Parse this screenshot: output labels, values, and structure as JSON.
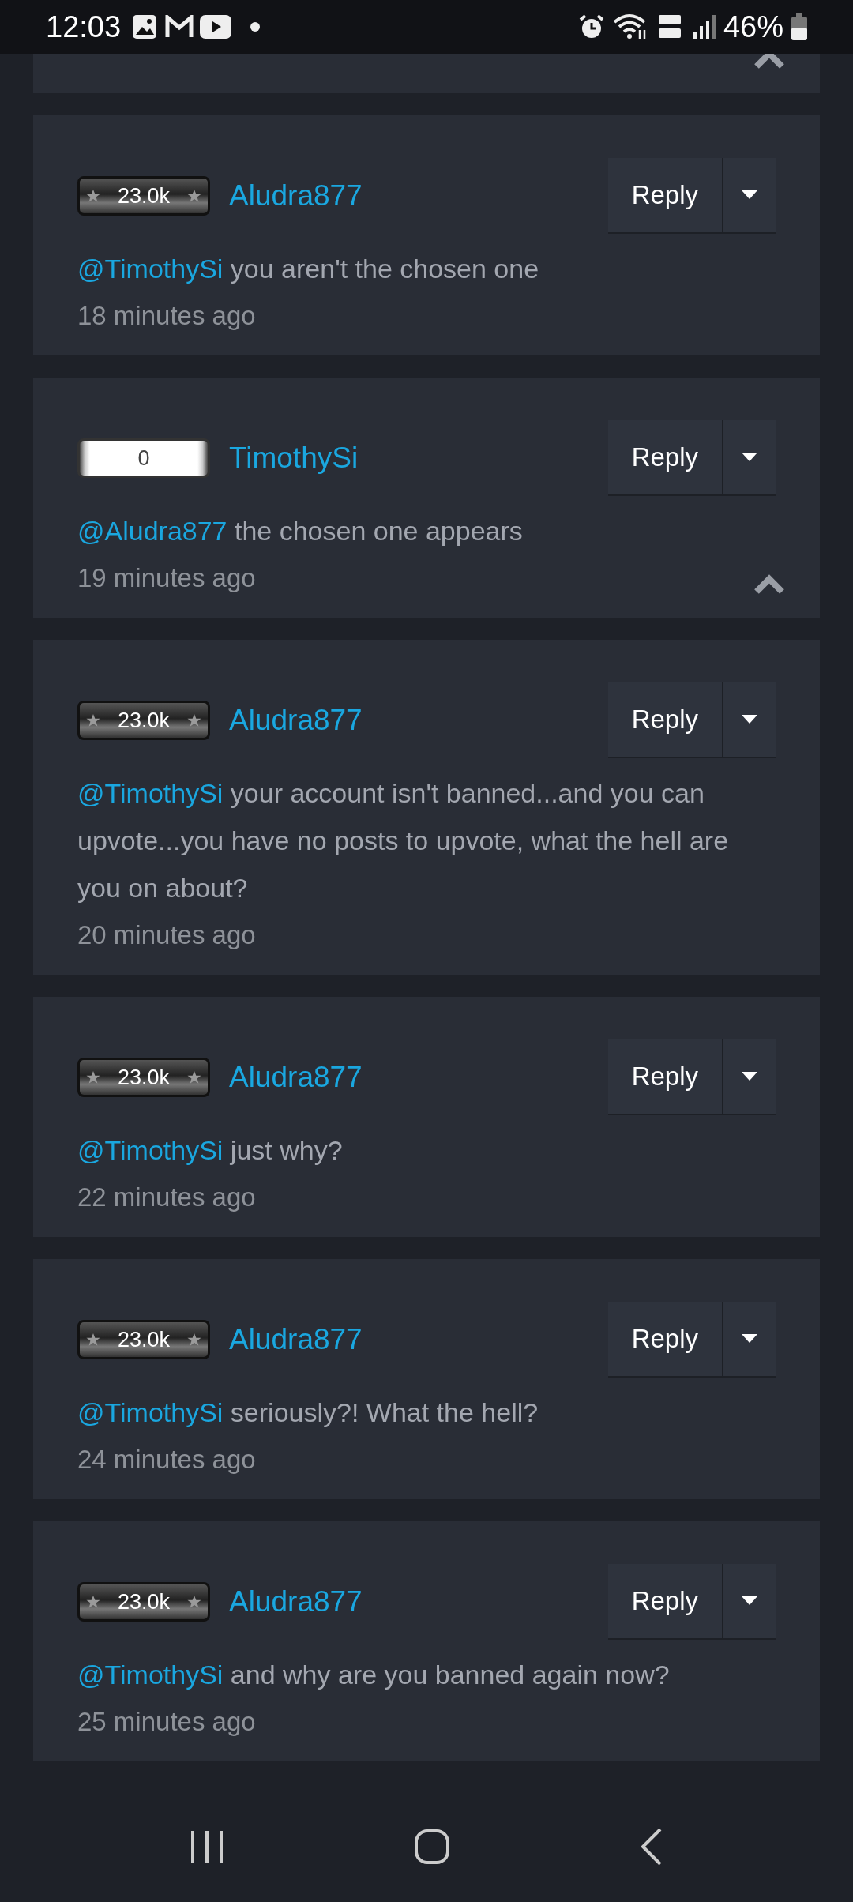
{
  "status_bar": {
    "time": "12:03",
    "battery": "46%"
  },
  "partial_comment": {
    "collapse": true
  },
  "comments": [
    {
      "badge": {
        "text": "23.0k",
        "kind": "dark"
      },
      "author": "Aludra877",
      "mention": "@TimothySi",
      "body": "you aren't the chosen one",
      "time": "18 minutes ago",
      "reply": "Reply",
      "collapse": false
    },
    {
      "badge": {
        "text": "0",
        "kind": "light"
      },
      "author": "TimothySi",
      "mention": "@Aludra877",
      "body": "the chosen one appears",
      "time": "19 minutes ago",
      "reply": "Reply",
      "collapse": true
    },
    {
      "badge": {
        "text": "23.0k",
        "kind": "dark"
      },
      "author": "Aludra877",
      "mention": "@TimothySi",
      "body": "your account isn't banned...and you can upvote...you have no posts to upvote, what the hell are you on about?",
      "time": "20 minutes ago",
      "reply": "Reply",
      "collapse": false
    },
    {
      "badge": {
        "text": "23.0k",
        "kind": "dark"
      },
      "author": "Aludra877",
      "mention": "@TimothySi",
      "body": "just why?",
      "time": "22 minutes ago",
      "reply": "Reply",
      "collapse": false
    },
    {
      "badge": {
        "text": "23.0k",
        "kind": "dark"
      },
      "author": "Aludra877",
      "mention": "@TimothySi",
      "body": "seriously?! What the hell?",
      "time": "24 minutes ago",
      "reply": "Reply",
      "collapse": false
    },
    {
      "badge": {
        "text": "23.0k",
        "kind": "dark"
      },
      "author": "Aludra877",
      "mention": "@TimothySi",
      "body": "and why are you banned again now?",
      "time": "25 minutes ago",
      "reply": "Reply",
      "collapse": false
    }
  ]
}
